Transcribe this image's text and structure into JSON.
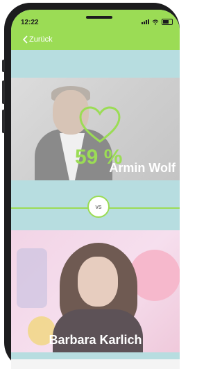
{
  "status": {
    "time": "12:22"
  },
  "nav": {
    "back_label": "Zurück"
  },
  "candidate_top": {
    "name": "Armin Wolf",
    "percentage": "59 %"
  },
  "vs": {
    "label": "vs"
  },
  "candidate_bottom": {
    "name": "Barbara Karlich"
  },
  "colors": {
    "accent": "#9bdc55",
    "band": "#b7dde0",
    "card_bottom_bg": "#f1d7e7"
  },
  "icons": [
    "back-chevron-icon",
    "signal-icon",
    "wifi-icon",
    "battery-icon",
    "heart-icon"
  ]
}
